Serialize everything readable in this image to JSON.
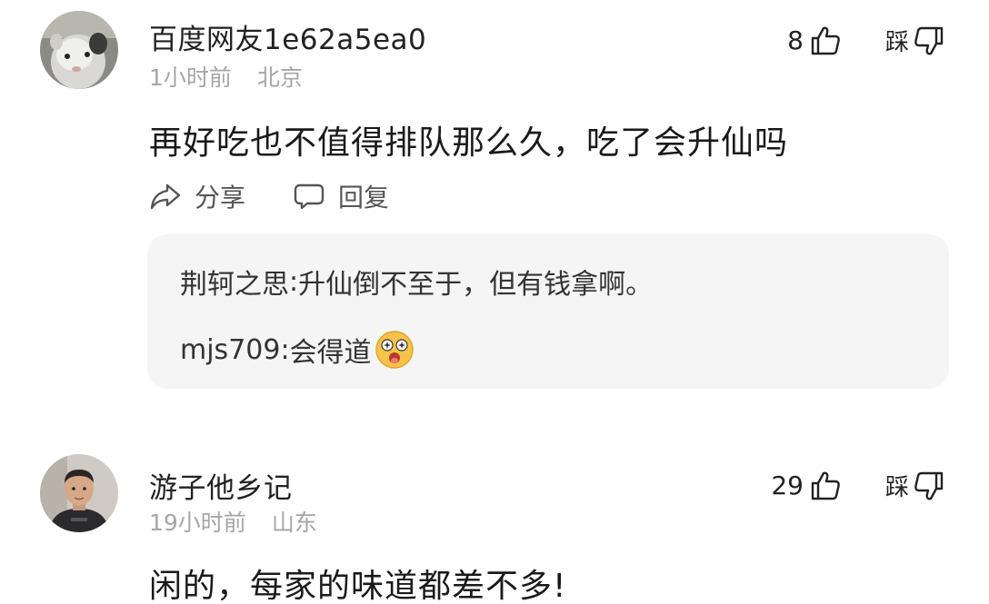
{
  "comments": [
    {
      "username": "百度网友1e62a5ea0",
      "time": "1小时前",
      "location": "北京",
      "likes": "8",
      "dislike_label": "踩",
      "text": "再好吃也不值得排队那么久，吃了会升仙吗",
      "avatar_icon": "guinea-pig-avatar",
      "actions": {
        "share": "分享",
        "reply": "回复"
      },
      "replies": [
        {
          "author": "荆轲之思",
          "separator": ": ",
          "text": "升仙倒不至于，但有钱拿啊。"
        },
        {
          "author": "mjs709",
          "separator": ": ",
          "text": "会得道",
          "emoji": "starry-eyed-face-emoji"
        }
      ]
    },
    {
      "username": "游子他乡记",
      "time": "19小时前",
      "location": "山东",
      "likes": "29",
      "dislike_label": "踩",
      "text": "闲的，每家的味道都差不多!",
      "avatar_icon": "man-photo-avatar"
    }
  ],
  "colors": {
    "meta_gray": "#a6a6a6",
    "reply_bg": "#f5f5f5",
    "emoji_yellow": "#f7c34a"
  }
}
